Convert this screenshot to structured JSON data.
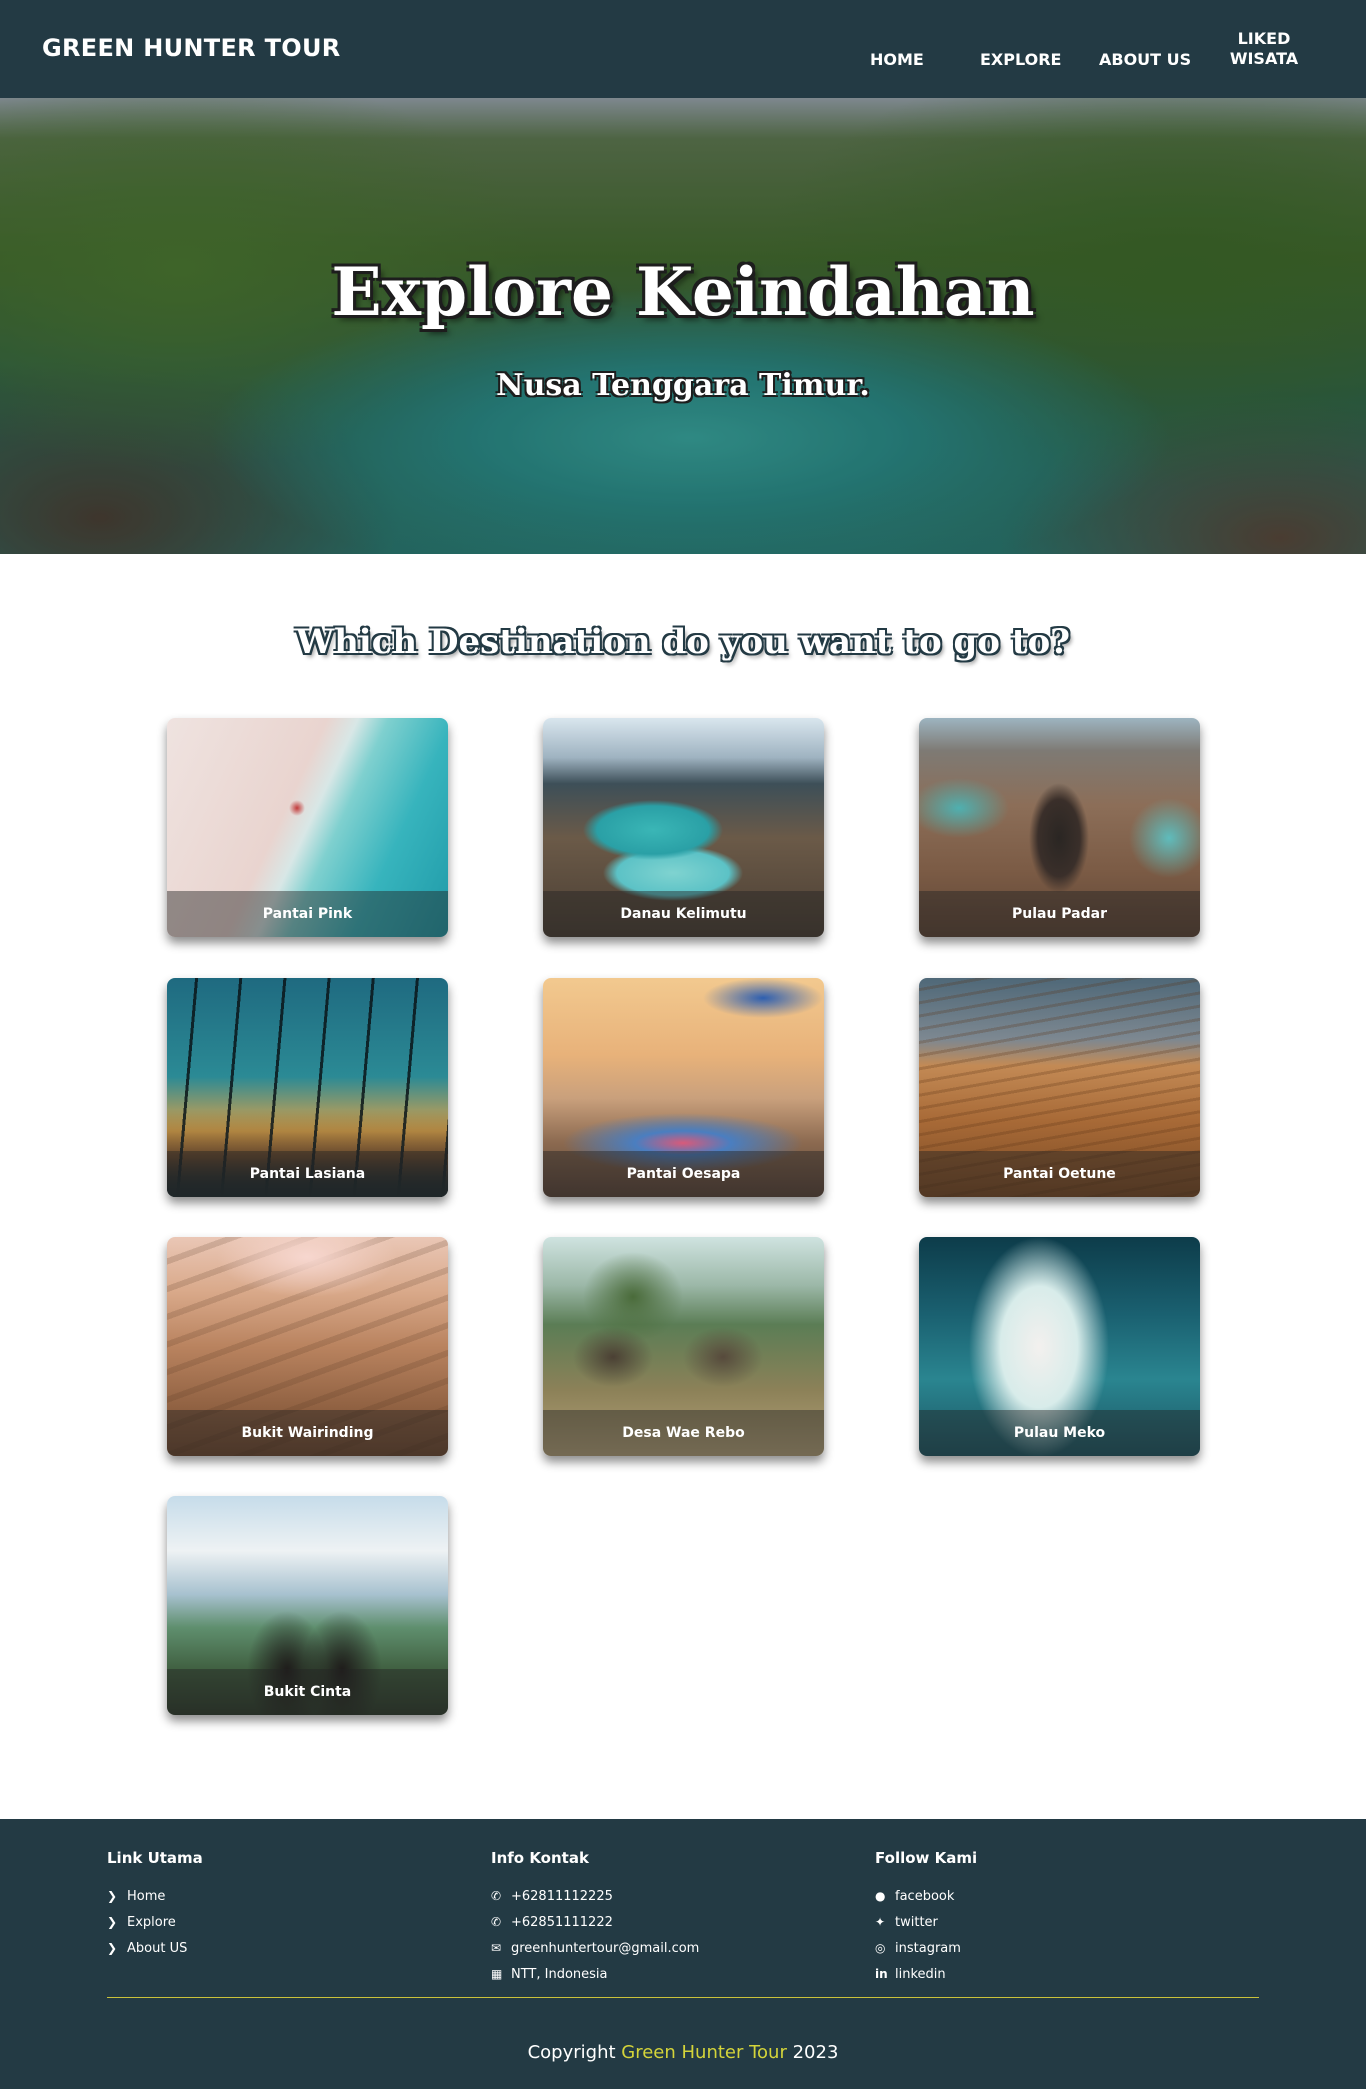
{
  "navbar": {
    "brand": "GREEN HUNTER TOUR",
    "items": [
      "HOME",
      "EXPLORE",
      "ABOUT US"
    ],
    "liked_line1": "LIKED",
    "liked_line2": "WISATA"
  },
  "hero": {
    "title": "Explore Keindahan",
    "subtitle": "Nusa Tenggara Timur."
  },
  "destinations": {
    "heading": "Which Destination do you want to go to?",
    "cards": [
      {
        "name": "Pantai Pink"
      },
      {
        "name": "Danau Kelimutu"
      },
      {
        "name": "Pulau Padar"
      },
      {
        "name": "Pantai Lasiana"
      },
      {
        "name": "Pantai Oesapa"
      },
      {
        "name": "Pantai Oetune"
      },
      {
        "name": "Bukit Wairinding"
      },
      {
        "name": "Desa Wae Rebo"
      },
      {
        "name": "Pulau Meko"
      },
      {
        "name": "Bukit Cinta"
      }
    ]
  },
  "footer": {
    "link_utama": {
      "heading": "Link Utama",
      "items": [
        "Home",
        "Explore",
        "About US"
      ],
      "icon": "chevron-right-icon"
    },
    "info_kontak": {
      "heading": "Info Kontak",
      "phone1": "+62811112225",
      "phone2": "+62851111222",
      "email": "greenhuntertour@gmail.com",
      "location": "NTT, Indonesia"
    },
    "follow_kami": {
      "heading": "Follow Kami",
      "items": [
        "facebook",
        "twitter",
        "instagram",
        "linkedin"
      ]
    },
    "copyright_prefix": "Copyright",
    "copyright_brand": "Green Hunter Tour",
    "copyright_year": "2023"
  },
  "colors": {
    "primary": "#233a44",
    "accent": "#d4d43a",
    "white": "#ffffff"
  }
}
